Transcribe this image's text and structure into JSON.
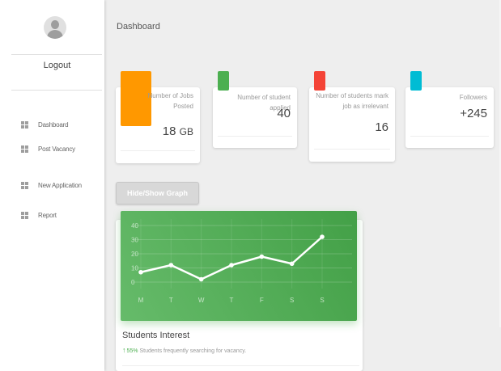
{
  "sidebar": {
    "logout_label": "Logout",
    "items": [
      {
        "label": "Dashboard",
        "icon": "grid-icon"
      },
      {
        "label": "Post Vacancy",
        "icon": "grid-icon"
      },
      {
        "label": "New Application",
        "icon": "grid-icon"
      },
      {
        "label": "Report",
        "icon": "grid-icon"
      }
    ]
  },
  "header": {
    "title": "Dashboard"
  },
  "cards": [
    {
      "category": "Number of Jobs Posted",
      "value_number": "18",
      "value_unit": "GB",
      "color": "#ff9800"
    },
    {
      "category": "Number of student applied",
      "value": "40",
      "color": "#4caf50"
    },
    {
      "category": "Number of students mark job as irrelevant",
      "value": "16",
      "color": "#f44336"
    },
    {
      "category": "Followers",
      "value": "+245",
      "color": "#00bcd4"
    }
  ],
  "toggle_button_label": "Hide/Show Graph",
  "chart_section": {
    "title": "Students Interest",
    "arrow": "↑",
    "percent": "55%",
    "subtitle": " Students frequently searching for vacancy."
  },
  "chart_data": {
    "type": "line",
    "categories": [
      "M",
      "T",
      "W",
      "T",
      "F",
      "S",
      "S"
    ],
    "series": [
      {
        "values": [
          7,
          12,
          2,
          12,
          18,
          13,
          32
        ]
      }
    ],
    "ylim": [
      0,
      40
    ],
    "yticks": [
      0,
      10,
      20,
      30,
      40
    ],
    "grid": true,
    "line_color": "#ffffff",
    "background_color": "#4caf50"
  }
}
